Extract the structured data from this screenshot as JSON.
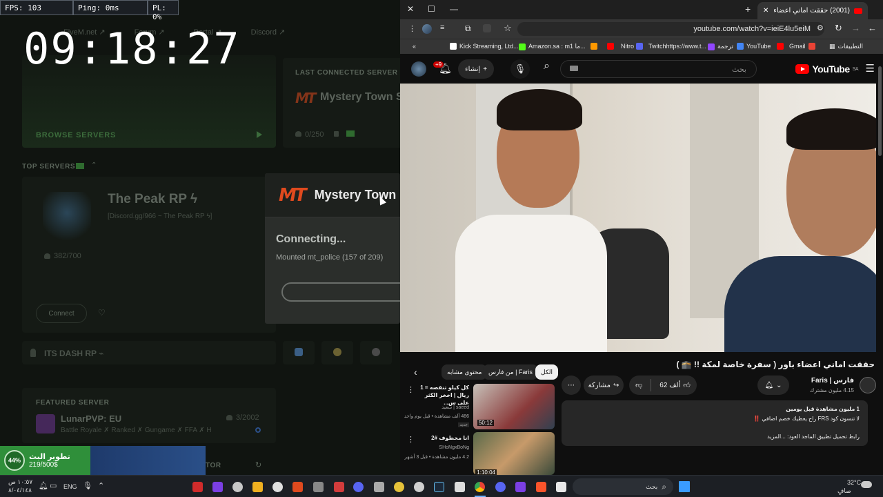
{
  "perf": {
    "fps": "FPS: 103",
    "ping": "Ping: 0ms",
    "pl": "PL: 0%"
  },
  "clock": "09:18:27",
  "launcher": {
    "nav": [
      "FiveM.net ↗",
      "Forum ↗",
      "Portal ↗",
      "Discord ↗"
    ],
    "last_connected_label": "LAST CONNECTED SERVER",
    "last_server_name": "Mystery Town S",
    "last_server_players": "0/250",
    "browse_servers": "BROWSE SERVERS",
    "top_servers_label": "TOP SERVERS",
    "top_server": {
      "name": "The Peak RP ϟ",
      "desc": "[Discord.gg/966 ~ The Peak RP ϟ]",
      "players": "382/700",
      "connect": "Connect"
    },
    "its_dash": "ITS DASH RP ⌁",
    "featured_label": "FEATURED SERVER",
    "featured": {
      "name": "LunarPVP: EU",
      "desc": "Battle Royale ✗ Ranked ✗ Gungame ✗ FFA ✗ H",
      "players": "3/2002"
    },
    "bottom_label_fragment": "TOR"
  },
  "connect_dialog": {
    "logo": "MT",
    "server": "Mystery Town",
    "status": "Connecting...",
    "detail": "Mounted mt_police (157 of 209)"
  },
  "boost": {
    "percent": "44%",
    "title": "تطوير البث",
    "amount": "219/500$"
  },
  "chrome": {
    "tab_title": "(2001) حققت اماني اعضاء باو",
    "url": "youtube.com/watch?v=ieiE4lu5eiM",
    "bookmarks": [
      "التطبيقات",
      "Gmail",
      "YouTube",
      "ترجمة",
      "Twitchhttps://www.t...",
      "Nitro",
      "Amazon.sa : m1 ما...",
      "Kick Streaming, Ltd...."
    ]
  },
  "youtube": {
    "logo_text": "YouTube",
    "logo_region": "SA",
    "search_placeholder": "بحث",
    "create_label": "إنشاء",
    "notif_badge": "+9",
    "video_title": "حققت اماني اعضاء باور ( سفرة خاصة لمكة !! 🕋 )",
    "channel_name": "فارس | Faris",
    "subscribers": "4.15 مليون مشترك",
    "likes": "62 ألف",
    "share": "مشاركة",
    "views_line": "1 مليون مشاهدة  قبل يومين",
    "desc_line1": "لا تنسون كود FRS راح يعطيك خصم اضافي ‼️",
    "desc_line2": "رابط تحميل تطبيق الماجد العود:  ...المزيد",
    "chips": [
      "الكل",
      "من فارس | Faris",
      "محتوى مشابه"
    ],
    "related": [
      {
        "title": "كل كيلو تنقصه = 1 ريال | اخخر الكثر على س...",
        "channel": "saeed | سعيد",
        "meta": "486 ألف مشاهدة • قبل يوم واحد",
        "badge": "جديد",
        "duration": "50:12"
      },
      {
        "title": "انا مخطوف #2",
        "channel": "SHoNgxBoNg",
        "meta": "4.2 مليون مشاهدة • قبل 3 أشهر",
        "duration": "1:10:04"
      }
    ]
  },
  "taskbar": {
    "lang": "ENG",
    "time": "١٠:٥٧ ص",
    "date": "٨/٠٤/١٤٨",
    "search": "بحث",
    "weather": "32°C",
    "weather_desc": "صافٍ"
  }
}
